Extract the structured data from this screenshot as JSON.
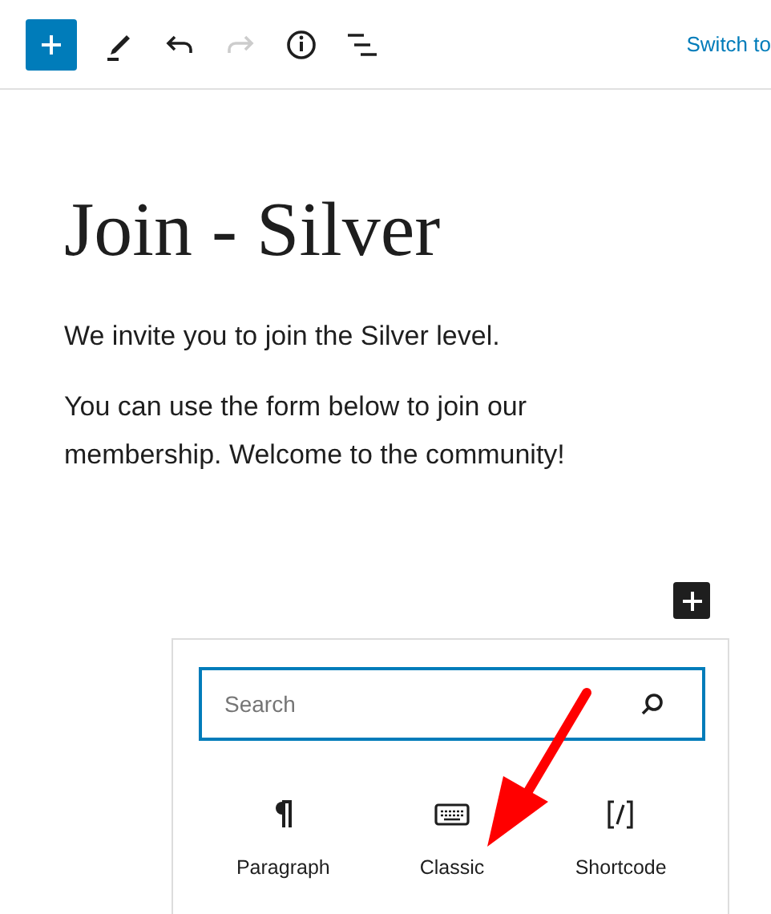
{
  "toolbar": {
    "tools": [
      {
        "kind": "add",
        "disabled": false
      },
      {
        "kind": "edit",
        "disabled": false
      },
      {
        "kind": "undo",
        "disabled": false
      },
      {
        "kind": "redo",
        "disabled": true
      },
      {
        "kind": "info",
        "disabled": false
      },
      {
        "kind": "outline",
        "disabled": false
      }
    ],
    "switch_link": "Switch to"
  },
  "post": {
    "title": "Join - Silver",
    "paragraphs": [
      "We invite you to join the Silver level.",
      "You can use the form below to join our membership. Welcome to the community!"
    ]
  },
  "inserter": {
    "search": {
      "placeholder": "Search"
    },
    "blocks": [
      {
        "kind": "paragraph",
        "label": "Paragraph"
      },
      {
        "kind": "classic",
        "label": "Classic"
      },
      {
        "kind": "shortcode",
        "label": "Shortcode"
      }
    ]
  }
}
